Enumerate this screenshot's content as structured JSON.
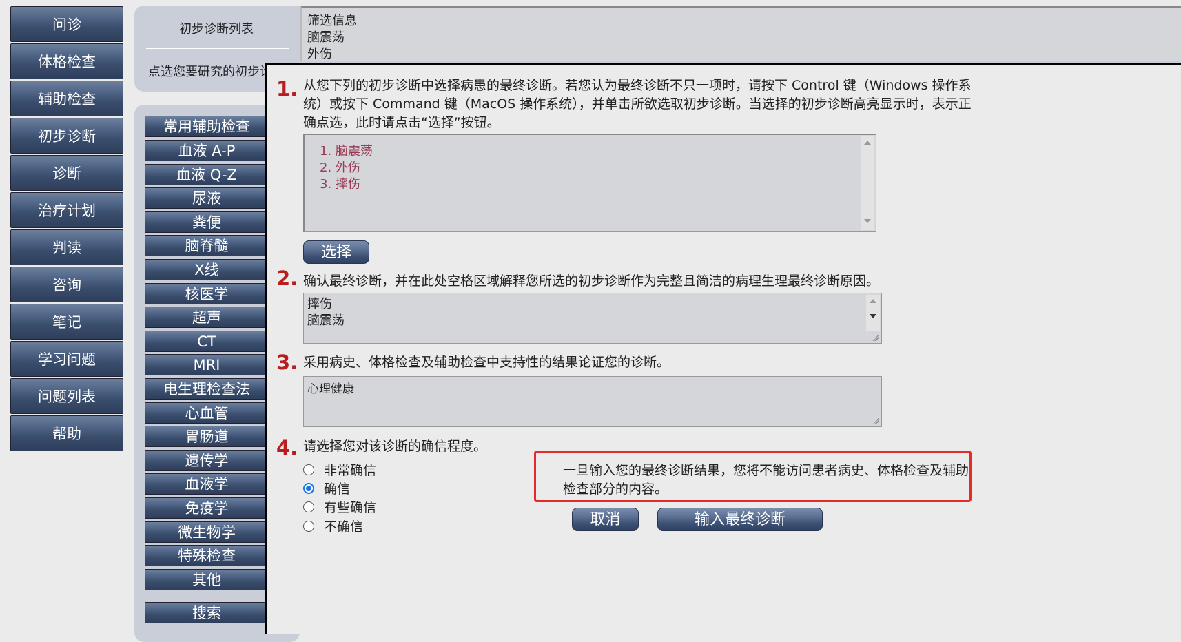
{
  "nav": {
    "items": [
      "问诊",
      "体格检查",
      "辅助检查",
      "初步诊断",
      "诊断",
      "治疗计划",
      "判读",
      "咨询",
      "笔记",
      "学习问题",
      "问题列表",
      "帮助"
    ]
  },
  "top_panel": {
    "list_title": "初步诊断列表",
    "instruction_partial": "点选您要研究的初步诊",
    "filter_lines": [
      "筛选信息",
      "脑震荡",
      "外伤"
    ]
  },
  "sub_nav": {
    "items": [
      "常用辅助检查",
      "血液 A-P",
      "血液 Q-Z",
      "尿液",
      "粪便",
      "脑脊髓",
      "X线",
      "核医学",
      "超声",
      "CT",
      "MRI",
      "电生理检查法",
      "心血管",
      "胃肠道",
      "遗传学",
      "血液学",
      "免疫学",
      "微生物学",
      "特殊检查",
      "其他"
    ],
    "search": "搜索"
  },
  "dialog": {
    "step1": {
      "number": "1.",
      "text": "从您下列的初步诊断中选择病患的最终诊断。若您认为最终诊断不只一项时，请按下 Control 键（Windows 操作系统）或按下 Command 键（MacOS 操作系统），并单击所欲选取初步诊断。当选择的初步诊断高亮显示时，表示正确点选，此时请点击“选择”按钮。",
      "options": [
        "1. 脑震荡",
        "2. 外伤",
        "3. 摔伤"
      ],
      "select_button": "选择"
    },
    "step2": {
      "number": "2.",
      "text": "确认最终诊断，并在此处空格区域解释您所选的初步诊断作为完整且简洁的病理生理最终诊断原因。",
      "lines": [
        "摔伤",
        "脑震荡"
      ]
    },
    "step3": {
      "number": "3.",
      "text": "采用病史、体格检查及辅助检查中支持性的结果论证您的诊断。",
      "value": "心理健康"
    },
    "step4": {
      "number": "4.",
      "text": "请选择您对该诊断的确信程度。",
      "radios": [
        "非常确信",
        "确信",
        "有些确信",
        "不确信"
      ],
      "selected_index": 1
    },
    "warning": "一旦输入您的最终诊断结果，您将不能访问患者病史、体格检查及辅助检查部分的内容。",
    "cancel_button": "取消",
    "submit_button": "输入最终诊断",
    "colors": {
      "number": "#b91e1e",
      "warning_border": "#e52a2a",
      "option_text": "#9a3a55"
    }
  }
}
